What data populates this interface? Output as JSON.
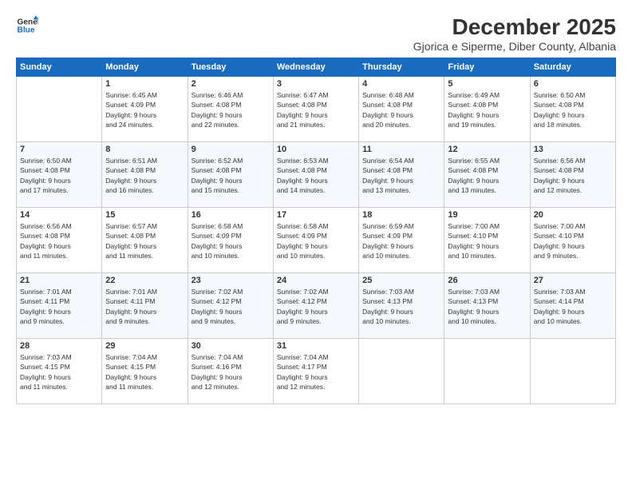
{
  "logo": {
    "line1": "General",
    "line2": "Blue"
  },
  "header": {
    "month": "December 2025",
    "location": "Gjorica e Siperme, Diber County, Albania"
  },
  "columns": [
    "Sunday",
    "Monday",
    "Tuesday",
    "Wednesday",
    "Thursday",
    "Friday",
    "Saturday"
  ],
  "weeks": [
    [
      {
        "day": "",
        "info": ""
      },
      {
        "day": "1",
        "info": "Sunrise: 6:45 AM\nSunset: 4:09 PM\nDaylight: 9 hours\nand 24 minutes."
      },
      {
        "day": "2",
        "info": "Sunrise: 6:46 AM\nSunset: 4:08 PM\nDaylight: 9 hours\nand 22 minutes."
      },
      {
        "day": "3",
        "info": "Sunrise: 6:47 AM\nSunset: 4:08 PM\nDaylight: 9 hours\nand 21 minutes."
      },
      {
        "day": "4",
        "info": "Sunrise: 6:48 AM\nSunset: 4:08 PM\nDaylight: 9 hours\nand 20 minutes."
      },
      {
        "day": "5",
        "info": "Sunrise: 6:49 AM\nSunset: 4:08 PM\nDaylight: 9 hours\nand 19 minutes."
      },
      {
        "day": "6",
        "info": "Sunrise: 6:50 AM\nSunset: 4:08 PM\nDaylight: 9 hours\nand 18 minutes."
      }
    ],
    [
      {
        "day": "7",
        "info": "Sunrise: 6:50 AM\nSunset: 4:08 PM\nDaylight: 9 hours\nand 17 minutes."
      },
      {
        "day": "8",
        "info": "Sunrise: 6:51 AM\nSunset: 4:08 PM\nDaylight: 9 hours\nand 16 minutes."
      },
      {
        "day": "9",
        "info": "Sunrise: 6:52 AM\nSunset: 4:08 PM\nDaylight: 9 hours\nand 15 minutes."
      },
      {
        "day": "10",
        "info": "Sunrise: 6:53 AM\nSunset: 4:08 PM\nDaylight: 9 hours\nand 14 minutes."
      },
      {
        "day": "11",
        "info": "Sunrise: 6:54 AM\nSunset: 4:08 PM\nDaylight: 9 hours\nand 13 minutes."
      },
      {
        "day": "12",
        "info": "Sunrise: 6:55 AM\nSunset: 4:08 PM\nDaylight: 9 hours\nand 13 minutes."
      },
      {
        "day": "13",
        "info": "Sunrise: 6:56 AM\nSunset: 4:08 PM\nDaylight: 9 hours\nand 12 minutes."
      }
    ],
    [
      {
        "day": "14",
        "info": "Sunrise: 6:56 AM\nSunset: 4:08 PM\nDaylight: 9 hours\nand 11 minutes."
      },
      {
        "day": "15",
        "info": "Sunrise: 6:57 AM\nSunset: 4:08 PM\nDaylight: 9 hours\nand 11 minutes."
      },
      {
        "day": "16",
        "info": "Sunrise: 6:58 AM\nSunset: 4:09 PM\nDaylight: 9 hours\nand 10 minutes."
      },
      {
        "day": "17",
        "info": "Sunrise: 6:58 AM\nSunset: 4:09 PM\nDaylight: 9 hours\nand 10 minutes."
      },
      {
        "day": "18",
        "info": "Sunrise: 6:59 AM\nSunset: 4:09 PM\nDaylight: 9 hours\nand 10 minutes."
      },
      {
        "day": "19",
        "info": "Sunrise: 7:00 AM\nSunset: 4:10 PM\nDaylight: 9 hours\nand 10 minutes."
      },
      {
        "day": "20",
        "info": "Sunrise: 7:00 AM\nSunset: 4:10 PM\nDaylight: 9 hours\nand 9 minutes."
      }
    ],
    [
      {
        "day": "21",
        "info": "Sunrise: 7:01 AM\nSunset: 4:11 PM\nDaylight: 9 hours\nand 9 minutes."
      },
      {
        "day": "22",
        "info": "Sunrise: 7:01 AM\nSunset: 4:11 PM\nDaylight: 9 hours\nand 9 minutes."
      },
      {
        "day": "23",
        "info": "Sunrise: 7:02 AM\nSunset: 4:12 PM\nDaylight: 9 hours\nand 9 minutes."
      },
      {
        "day": "24",
        "info": "Sunrise: 7:02 AM\nSunset: 4:12 PM\nDaylight: 9 hours\nand 9 minutes."
      },
      {
        "day": "25",
        "info": "Sunrise: 7:03 AM\nSunset: 4:13 PM\nDaylight: 9 hours\nand 10 minutes."
      },
      {
        "day": "26",
        "info": "Sunrise: 7:03 AM\nSunset: 4:13 PM\nDaylight: 9 hours\nand 10 minutes."
      },
      {
        "day": "27",
        "info": "Sunrise: 7:03 AM\nSunset: 4:14 PM\nDaylight: 9 hours\nand 10 minutes."
      }
    ],
    [
      {
        "day": "28",
        "info": "Sunrise: 7:03 AM\nSunset: 4:15 PM\nDaylight: 9 hours\nand 11 minutes."
      },
      {
        "day": "29",
        "info": "Sunrise: 7:04 AM\nSunset: 4:15 PM\nDaylight: 9 hours\nand 11 minutes."
      },
      {
        "day": "30",
        "info": "Sunrise: 7:04 AM\nSunset: 4:16 PM\nDaylight: 9 hours\nand 12 minutes."
      },
      {
        "day": "31",
        "info": "Sunrise: 7:04 AM\nSunset: 4:17 PM\nDaylight: 9 hours\nand 12 minutes."
      },
      {
        "day": "",
        "info": ""
      },
      {
        "day": "",
        "info": ""
      },
      {
        "day": "",
        "info": ""
      }
    ]
  ]
}
